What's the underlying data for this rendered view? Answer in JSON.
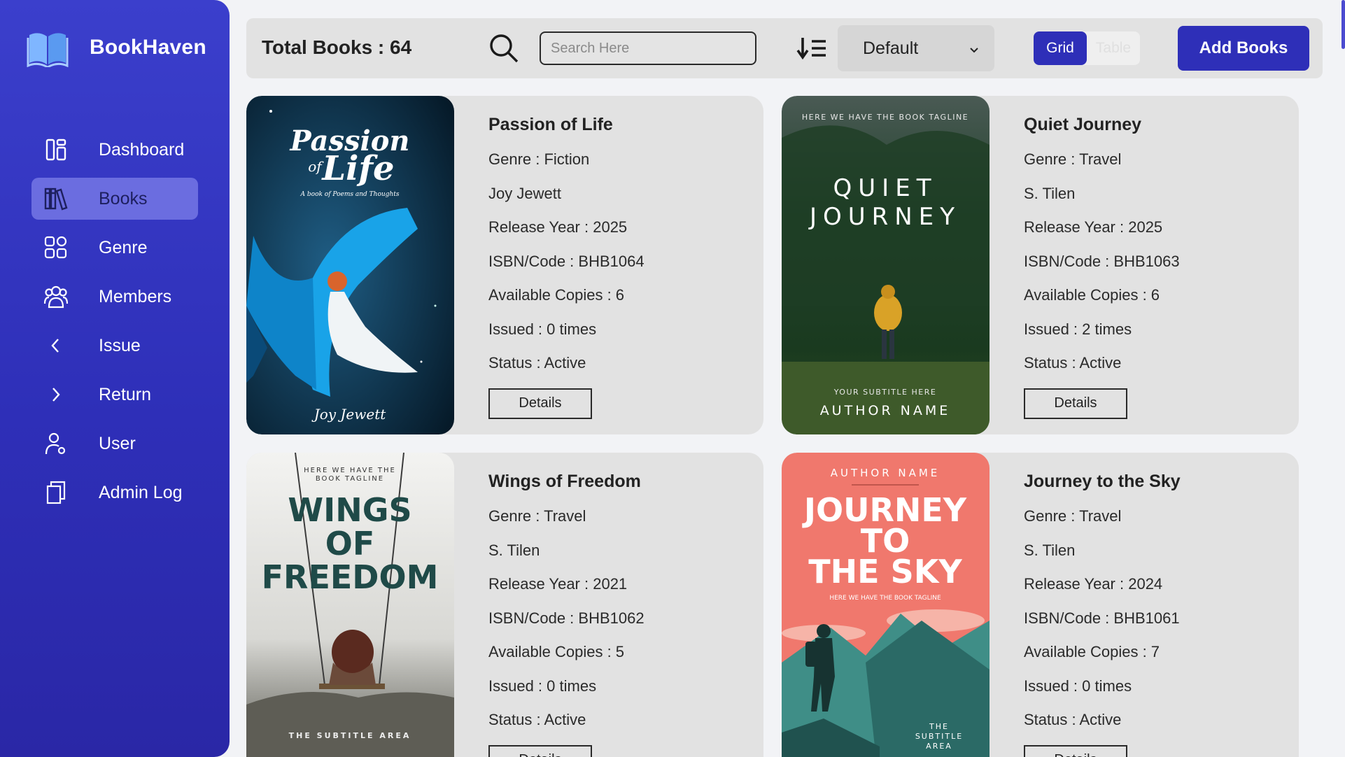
{
  "brand": {
    "name": "BookHaven"
  },
  "nav": [
    {
      "label": "Dashboard",
      "icon": "dashboard-icon"
    },
    {
      "label": "Books",
      "icon": "books-icon",
      "active": true
    },
    {
      "label": "Genre",
      "icon": "grid-icon"
    },
    {
      "label": "Members",
      "icon": "members-icon"
    },
    {
      "label": "Issue",
      "icon": "chevron-left-icon"
    },
    {
      "label": "Return",
      "icon": "chevron-right-icon"
    },
    {
      "label": "User",
      "icon": "user-icon"
    },
    {
      "label": "Admin Log",
      "icon": "copy-icon"
    }
  ],
  "toolbar": {
    "total": "Total Books : 64",
    "search_placeholder": "Search Here",
    "sort_value": "Default",
    "view_grid": "Grid",
    "view_table": "Table",
    "add_label": "Add Books"
  },
  "colors": {
    "accent": "#2e2fb8",
    "sidebar": "#3b3fcc",
    "active_nav": "#6b6de0",
    "card": "#e2e2e2"
  },
  "books": [
    {
      "title": "Passion of Life",
      "genre": "Genre : Fiction",
      "author": "Joy Jewett",
      "year": "Release Year : 2025",
      "isbn": "ISBN/Code : BHB1064",
      "copies": "Available Copies : 6",
      "issued": "Issued : 0 times",
      "status": "Status : Active",
      "details": "Details",
      "cover": {
        "line1": "Passion",
        "line2": "of",
        "line3": "Life",
        "tagline": "A book of Poems and Thoughts",
        "author": "Joy Jewett"
      }
    },
    {
      "title": "Quiet Journey",
      "genre": "Genre : Travel",
      "author": "S. Tilen",
      "year": "Release Year : 2025",
      "isbn": "ISBN/Code : BHB1063",
      "copies": "Available Copies : 6",
      "issued": "Issued : 2 times",
      "status": "Status : Active",
      "details": "Details",
      "cover": {
        "tagline": "HERE WE HAVE THE BOOK TAGLINE",
        "line1": "QUIET",
        "line2": "JOURNEY",
        "subtitle": "YOUR SUBTITLE HERE",
        "author": "AUTHOR NAME"
      }
    },
    {
      "title": "Wings of Freedom",
      "genre": "Genre : Travel",
      "author": "S. Tilen",
      "year": "Release Year : 2021",
      "isbn": "ISBN/Code : BHB1062",
      "copies": "Available Copies : 5",
      "issued": "Issued : 0 times",
      "status": "Status : Active",
      "details": "Details",
      "cover": {
        "tagline1": "HERE WE HAVE THE",
        "tagline2": "BOOK TAGLINE",
        "line1": "WINGS",
        "line2": "OF",
        "line3": "FREEDOM",
        "subtitle": "THE SUBTITLE AREA"
      }
    },
    {
      "title": "Journey to the Sky",
      "genre": "Genre : Travel",
      "author": "S. Tilen",
      "year": "Release Year : 2024",
      "isbn": "ISBN/Code : BHB1061",
      "copies": "Available Copies : 7",
      "issued": "Issued : 0 times",
      "status": "Status : Active",
      "details": "Details",
      "cover": {
        "author": "AUTHOR NAME",
        "line1": "JOURNEY",
        "line2": "TO",
        "line3": "THE SKY",
        "tagline": "HERE WE HAVE THE BOOK TAGLINE",
        "sub1": "THE",
        "sub2": "SUBTITLE",
        "sub3": "AREA"
      }
    }
  ]
}
